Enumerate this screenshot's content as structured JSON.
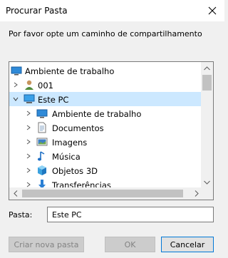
{
  "dialog": {
    "title": "Procurar Pasta",
    "instruction": "Por favor opte um caminho de compartilhamento"
  },
  "tree": {
    "items": [
      {
        "label": "Ambiente de trabalho",
        "icon": "desktop-icon",
        "expander": "none",
        "selected": false
      },
      {
        "label": "001",
        "icon": "user-icon",
        "expander": "collapsed",
        "selected": false
      },
      {
        "label": "Este PC",
        "icon": "computer-icon",
        "expander": "expanded",
        "selected": true
      },
      {
        "label": "Ambiente de trabalho",
        "icon": "desktop-icon",
        "expander": "collapsed",
        "selected": false
      },
      {
        "label": "Documentos",
        "icon": "documents-icon",
        "expander": "collapsed",
        "selected": false
      },
      {
        "label": "Imagens",
        "icon": "pictures-icon",
        "expander": "collapsed",
        "selected": false
      },
      {
        "label": "Música",
        "icon": "music-icon",
        "expander": "collapsed",
        "selected": false
      },
      {
        "label": "Objetos 3D",
        "icon": "3d-objects-icon",
        "expander": "collapsed",
        "selected": false
      },
      {
        "label": "Transferências",
        "icon": "downloads-icon",
        "expander": "collapsed",
        "selected": false
      }
    ]
  },
  "folder": {
    "label": "Pasta:",
    "value": "Este PC"
  },
  "buttons": {
    "new_folder": "Criar nova pasta",
    "ok": "OK",
    "cancel": "Cancelar"
  },
  "colors": {
    "selection": "#cce8ff",
    "accent": "#0078d7"
  }
}
